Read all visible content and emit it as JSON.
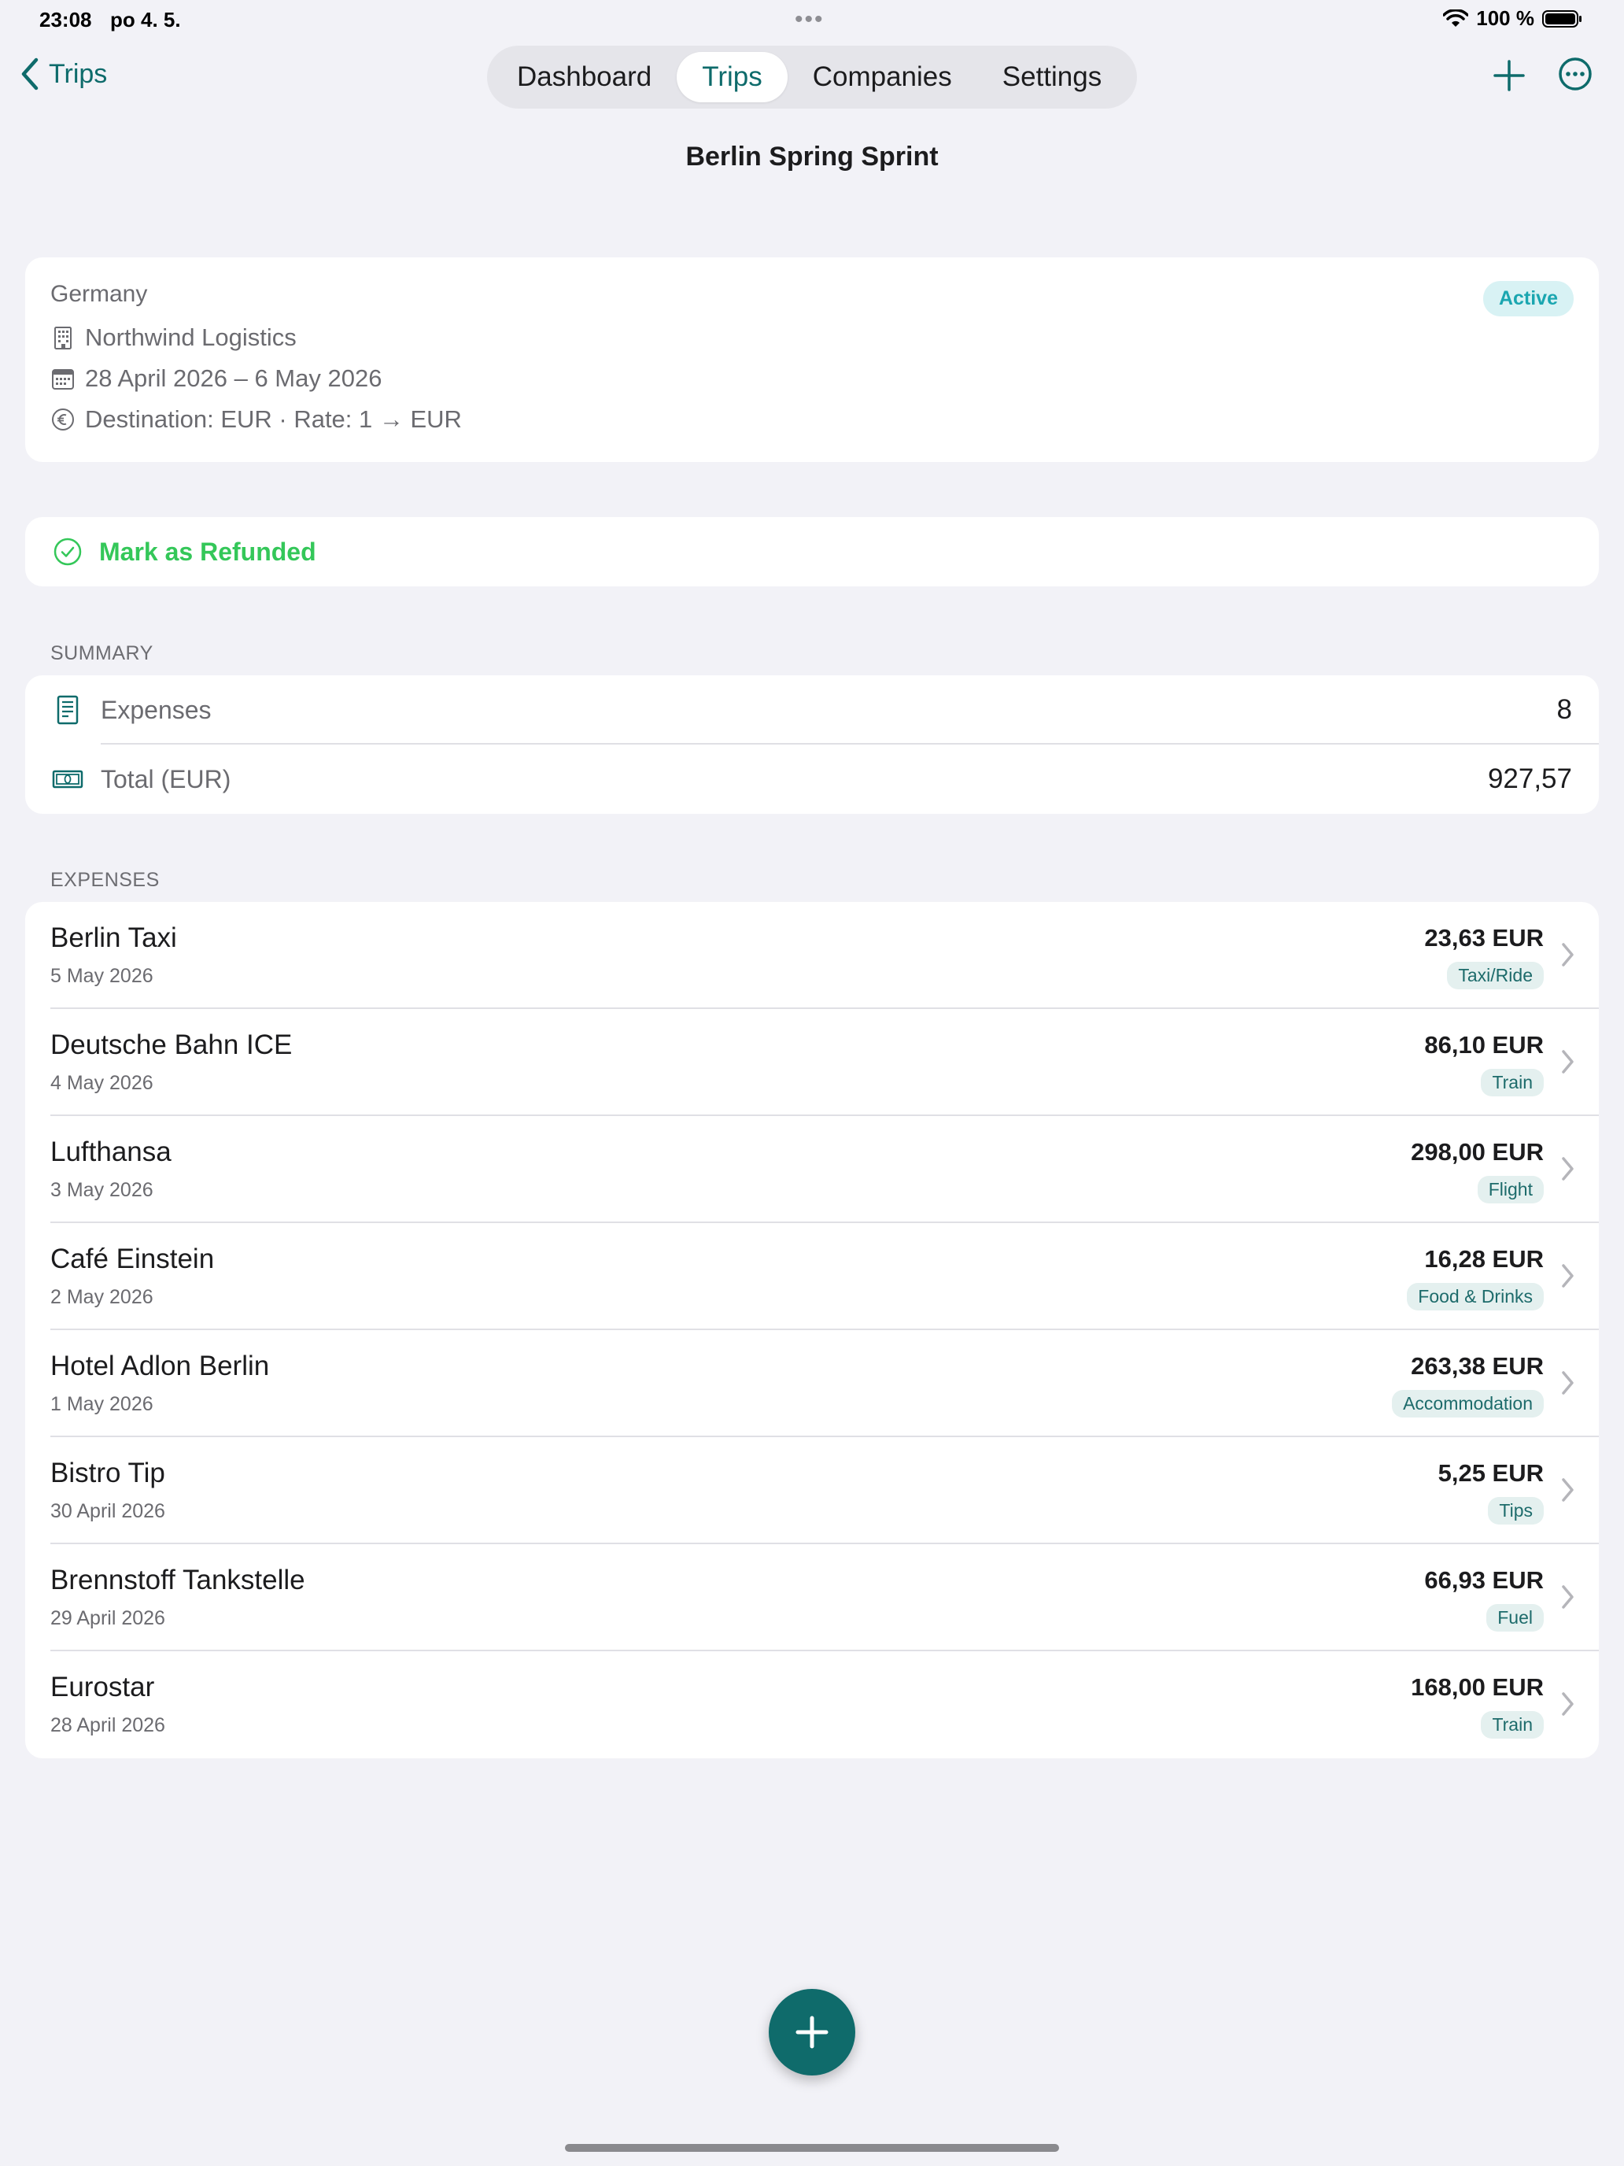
{
  "status_bar": {
    "time": "23:08",
    "date": "po 4. 5.",
    "battery": "100 %"
  },
  "nav": {
    "back_label": "Trips",
    "segments": [
      {
        "label": "Dashboard"
      },
      {
        "label": "Trips"
      },
      {
        "label": "Companies"
      },
      {
        "label": "Settings"
      }
    ],
    "active_segment": "Trips"
  },
  "page_title": "Berlin Spring Sprint",
  "trip": {
    "country": "Germany",
    "status": "Active",
    "company": "Northwind Logistics",
    "dates": "28 April 2026 – 6 May 2026",
    "currency": "Destination: EUR · Rate: 1 → EUR"
  },
  "refund_label": "Mark as Refunded",
  "summary": {
    "header": "SUMMARY",
    "expenses_label": "Expenses",
    "expenses_count": "8",
    "total_label": "Total (EUR)",
    "total_value": "927,57"
  },
  "expenses": {
    "header": "EXPENSES",
    "items": [
      {
        "name": "Berlin Taxi",
        "date": "5 May 2026",
        "amount": "23,63 EUR",
        "category": "Taxi/Ride"
      },
      {
        "name": "Deutsche Bahn ICE",
        "date": "4 May 2026",
        "amount": "86,10 EUR",
        "category": "Train"
      },
      {
        "name": "Lufthansa",
        "date": "3 May 2026",
        "amount": "298,00 EUR",
        "category": "Flight"
      },
      {
        "name": "Café Einstein",
        "date": "2 May 2026",
        "amount": "16,28 EUR",
        "category": "Food & Drinks"
      },
      {
        "name": "Hotel Adlon Berlin",
        "date": "1 May 2026",
        "amount": "263,38 EUR",
        "category": "Accommodation"
      },
      {
        "name": "Bistro Tip",
        "date": "30 April 2026",
        "amount": "5,25 EUR",
        "category": "Tips"
      },
      {
        "name": "Brennstoff Tankstelle",
        "date": "29 April 2026",
        "amount": "66,93 EUR",
        "category": "Fuel"
      },
      {
        "name": "Eurostar",
        "date": "28 April 2026",
        "amount": "168,00 EUR",
        "category": "Train"
      }
    ]
  },
  "colors": {
    "accent": "#0e6b6b",
    "success": "#34c759",
    "badge_bg": "#d8f2f4",
    "badge_text": "#1aa6b0",
    "background": "#f2f2f7"
  }
}
